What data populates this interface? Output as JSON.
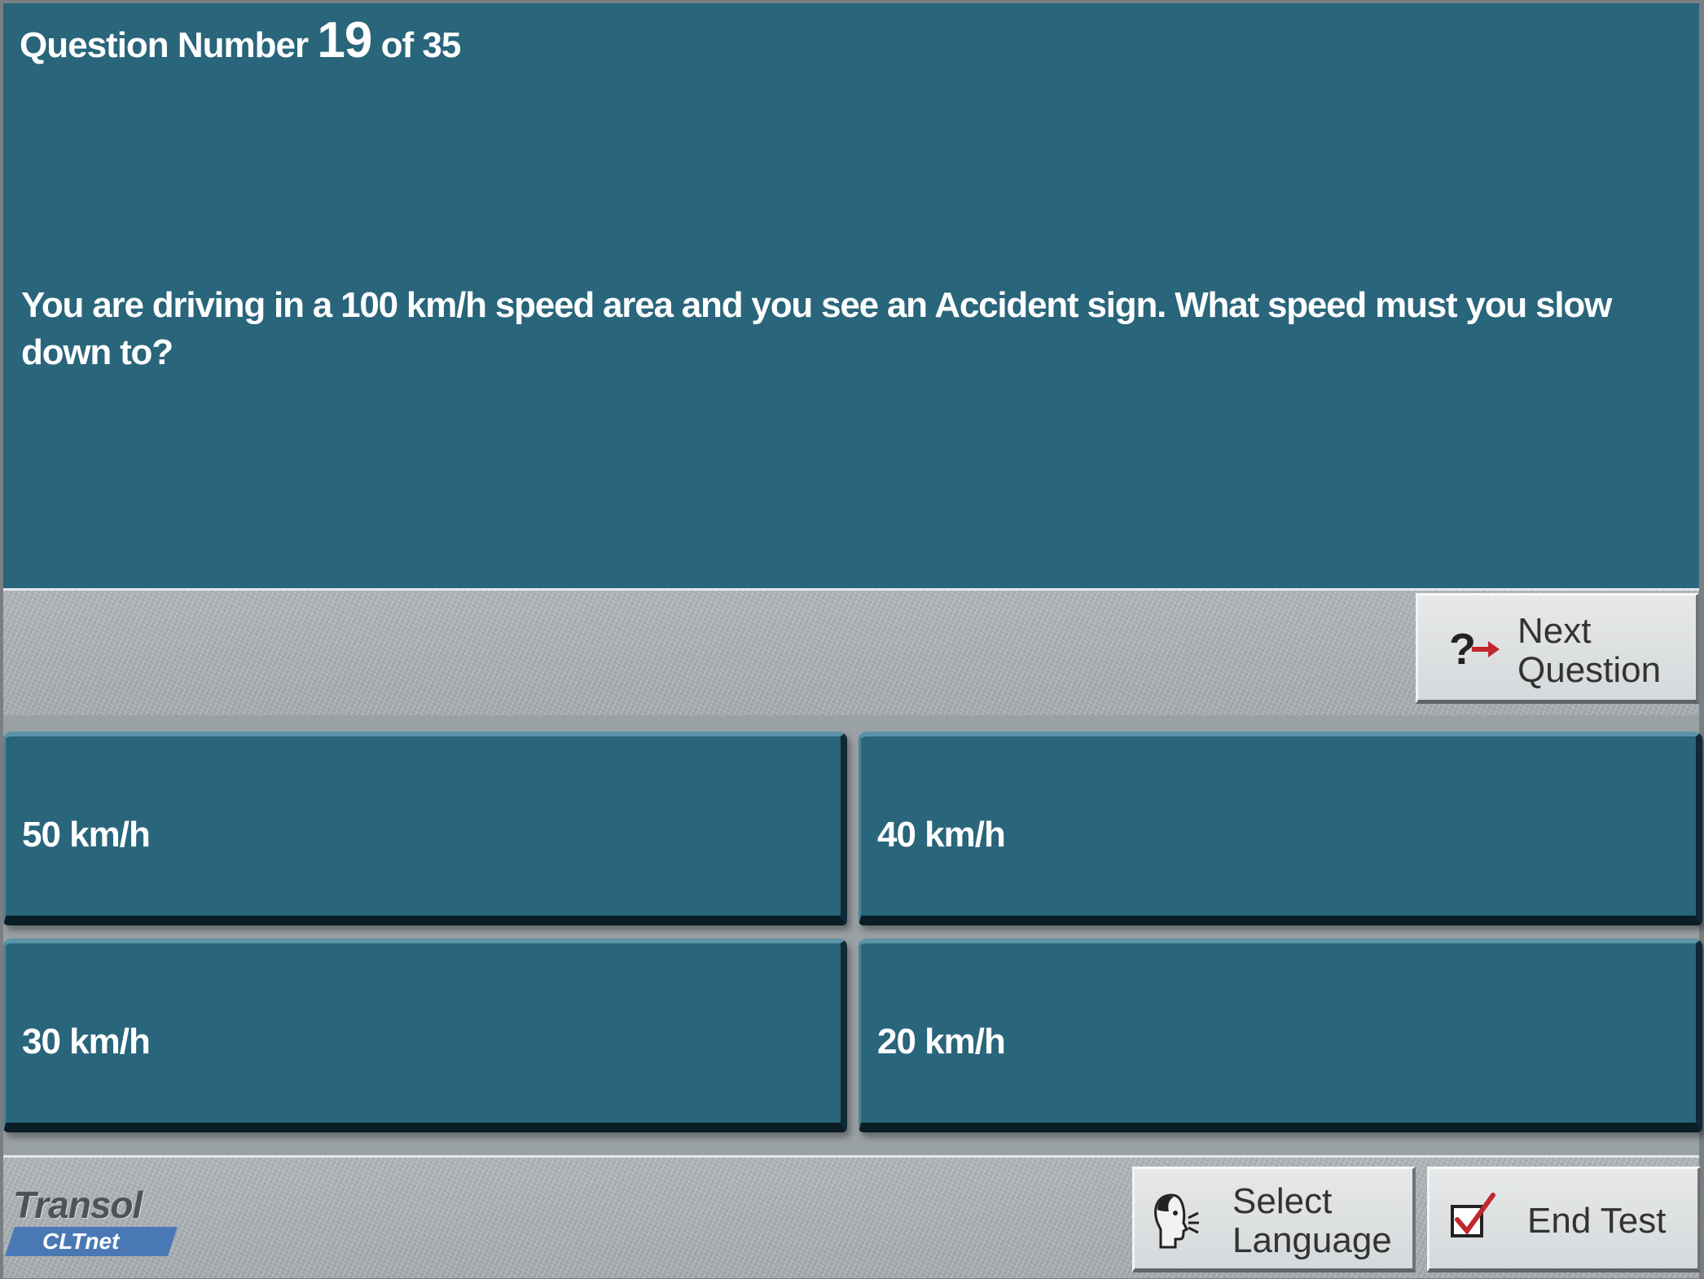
{
  "header": {
    "prefix": "Question Number",
    "number": "19",
    "suffix": "of 35"
  },
  "question": {
    "text": "You are driving in a 100 km/h speed area and you see an Accident sign. What speed must you slow down to?"
  },
  "answers": [
    {
      "label": "50 km/h"
    },
    {
      "label": "40 km/h"
    },
    {
      "label": "30 km/h"
    },
    {
      "label": "20 km/h"
    }
  ],
  "buttons": {
    "next_line1": "Next",
    "next_line2": "Question",
    "language_line1": "Select",
    "language_line2": "Language",
    "end_test": "End Test"
  },
  "logo": {
    "brand": "Transol",
    "product": "CLTnet"
  },
  "icons": {
    "next": "question-arrow-icon",
    "language": "speaking-head-icon",
    "end": "checkbox-tick-icon"
  },
  "colors": {
    "panel": "#29657b",
    "accent_red": "#c0282d",
    "logo_blue": "#4a78b5"
  }
}
